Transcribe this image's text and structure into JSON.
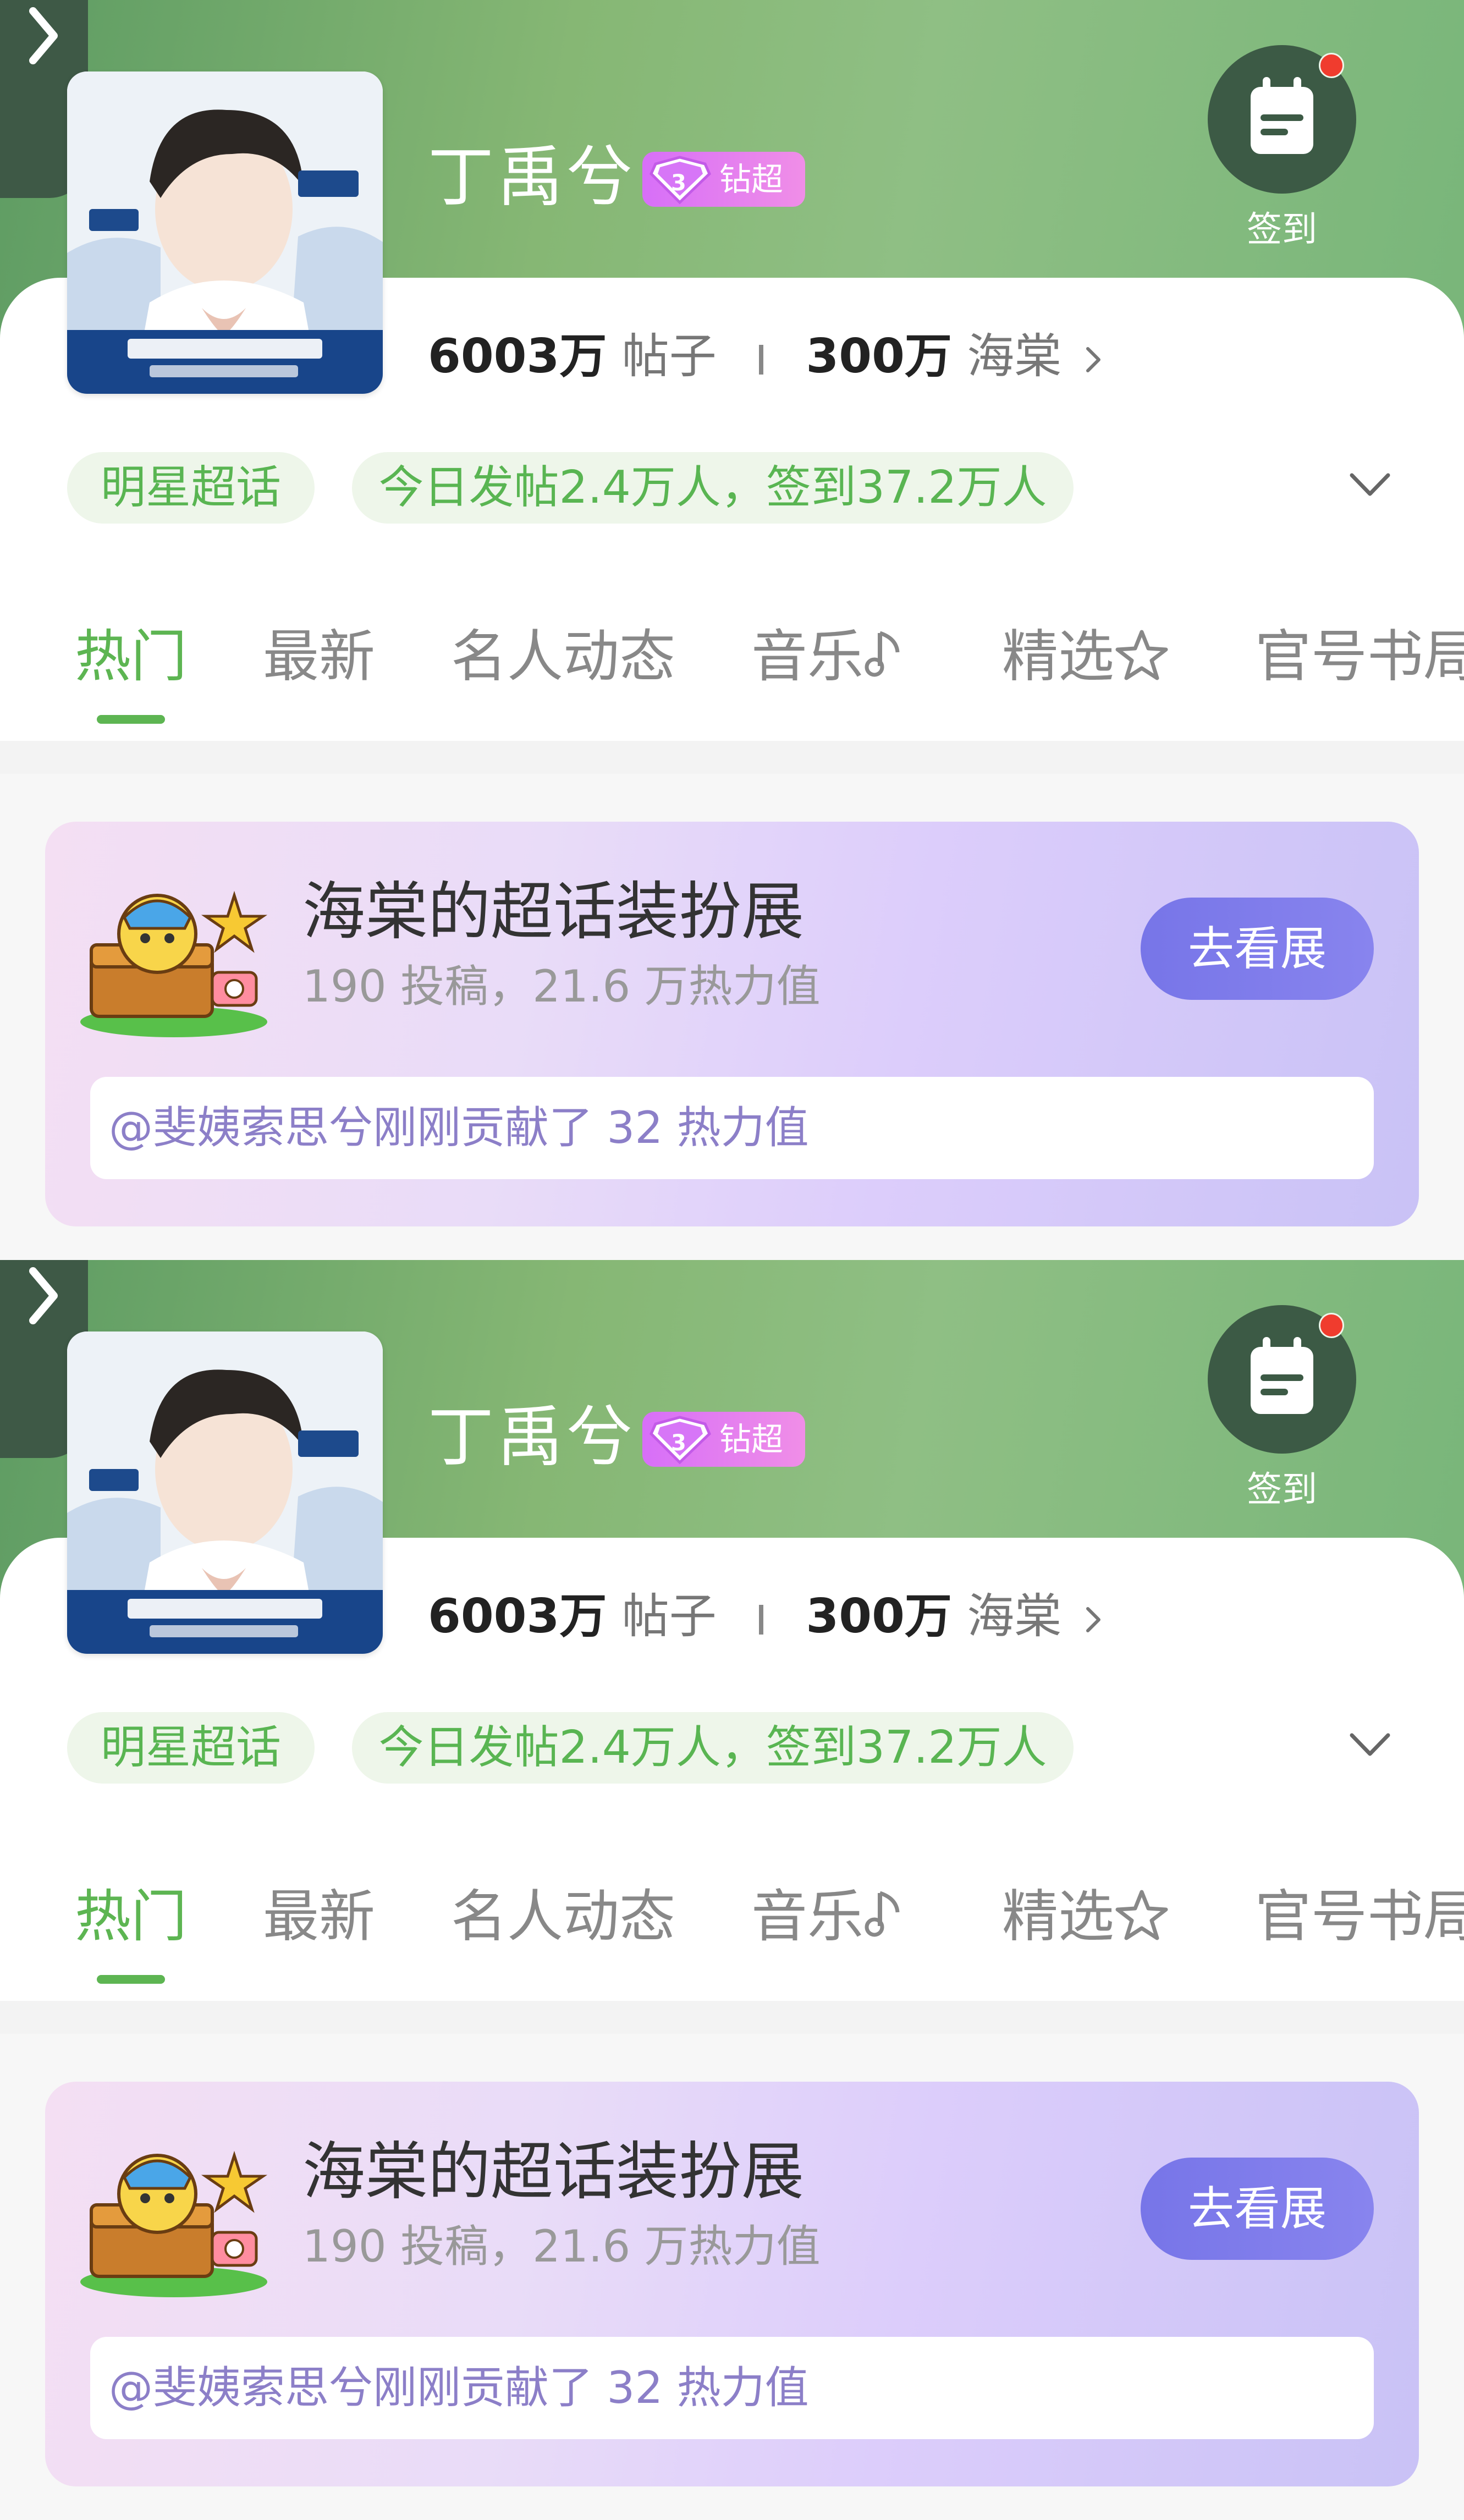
{
  "topic": {
    "title": "丁禹兮",
    "badge_label": "钻超",
    "cover_alt": "丁禹兮 poster",
    "checkin_label": "签到"
  },
  "stats": {
    "posts_count": "6003万",
    "posts_label": "帖子",
    "fans_count": "300万",
    "fans_label": "海棠"
  },
  "chips": {
    "category": "明星超话",
    "activity": "今日发帖2.4万人，签到37.2万人"
  },
  "tabs": [
    "热门",
    "最新",
    "名人动态",
    "音乐",
    "精选",
    "官号书局"
  ],
  "exhibit": {
    "title": "海棠的超话装扮展",
    "subtitle": "190 投稿，21.6 万热力值",
    "button": "去看展",
    "feed": "@斐姨索思兮刚刚贡献了 32 热力值"
  },
  "colors": {
    "accent_green": "#5db552",
    "hero_green": "#86b774",
    "checkin_dark": "#3c5a45",
    "badge_pink": "#e07df3",
    "exhibit_button": "#7775e8",
    "notification_red": "#f03c2e"
  },
  "icons": {
    "checkin": "calendar-icon",
    "expand": "chevron-down-icon",
    "music": "music-note-icon",
    "featured": "star-icon",
    "side": "chevron-right-icon"
  }
}
